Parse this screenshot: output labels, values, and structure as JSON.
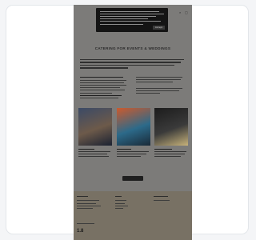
{
  "preview": {
    "page_title": "CATERING FOR EVENTS & WEDDINGS",
    "cookie_banner": {
      "accept_label": "Accept"
    },
    "header": {
      "icons": [
        "search-icon",
        "bag-icon"
      ]
    },
    "nav": {
      "items": [
        "",
        "",
        "",
        "",
        ""
      ]
    },
    "photos": [
      {
        "name": "chef-photo",
        "colors": [
          "#3b4a66",
          "#6d5a4a",
          "#1b2232"
        ]
      },
      {
        "name": "dishes-photo",
        "colors": [
          "#cc5a2e",
          "#2c6a8a",
          "#1a2a38"
        ]
      },
      {
        "name": "kitchen-photo",
        "colors": [
          "#1c1c1c",
          "#3a3a3a",
          "#c7b27a"
        ]
      }
    ],
    "footer": {
      "logo": "1.8"
    }
  }
}
